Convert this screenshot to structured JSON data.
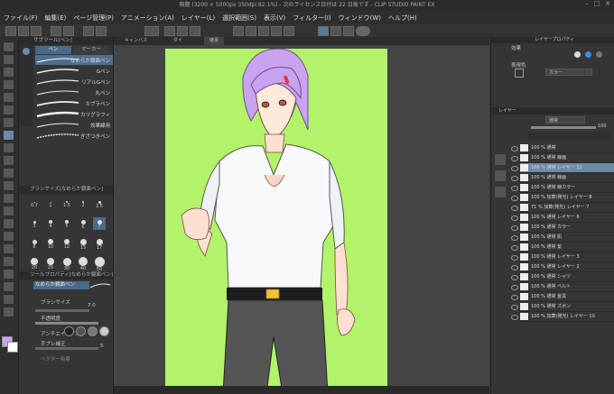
{
  "titlebar": {
    "title": "無題 (3200 × 5000px 350dpi 82.1%) - 次のライセンス日付は 22 日後です - CLIP STUDIO PAINT EX"
  },
  "menu": [
    "ファイル(F)",
    "編集(E)",
    "ページ管理(P)",
    "アニメーション(A)",
    "レイヤー(L)",
    "選択範囲(S)",
    "表示(V)",
    "フィルター(I)",
    "ウィンドウ(W)",
    "ヘルプ(H)"
  ],
  "canvas_tabs": [
    "キャンバス",
    "ダイ",
    "継承"
  ],
  "subtool": {
    "header": "サブツール[ペン]",
    "tabs": [
      "ペン",
      "マーカー"
    ],
    "brushes": [
      "なめらか鏡面ペン",
      "Gペン",
      "リアルGペン",
      "丸ペン",
      "カブラペン",
      "カリグラフィ",
      "効果線用",
      "ぎざつきペン"
    ],
    "size_header": "ブラシサイズ[なめらか鏡面ペン]",
    "sizes": [
      "0.7",
      "1",
      "1.5",
      "2",
      "2.5",
      "3",
      "4",
      "5",
      "6",
      "7",
      "8",
      "10",
      "12",
      "15",
      "17",
      "20",
      "25",
      "30",
      "40",
      "50"
    ],
    "detail_header": "ツールプロパティ[なめらか鏡面ペン]",
    "detail_name": "なめらか鏡面ペン",
    "props": {
      "brush_size_label": "ブラシサイズ",
      "brush_size_value": "7.0",
      "opacity_label": "不透明度",
      "antialias_label": "アンチエイリアス",
      "stabilize_label": "手ブレ補正",
      "stabilize_value": "5",
      "vector_label": "ベクター吸着"
    }
  },
  "color": {
    "header": "レイヤープロパティ",
    "effect_label": "効果",
    "display_color_label": "表現色",
    "display_color_value": "カラー"
  },
  "layer_panel": {
    "header": "レイヤー",
    "blend": "通常",
    "opacity": "100",
    "layers": [
      {
        "name": "100 % 通常",
        "selected": false
      },
      {
        "name": "100 % 通常 線画",
        "selected": false
      },
      {
        "name": "100 % 通常 レイヤー 11",
        "selected": true
      },
      {
        "name": "100 % 通常 線画",
        "selected": false
      },
      {
        "name": "100 % 通常 線カラー",
        "selected": false
      },
      {
        "name": "100 % 加算(発光) レイヤー 8",
        "selected": false
      },
      {
        "name": "71 % 加算(発光) レイヤー 7",
        "selected": false
      },
      {
        "name": "100 % 通常 レイヤー 6",
        "selected": false
      },
      {
        "name": "100 % 通常 カラー",
        "selected": false
      },
      {
        "name": "100 % 通常 肌",
        "selected": false
      },
      {
        "name": "100 % 通常 髪",
        "selected": false
      },
      {
        "name": "100 % 通常 レイヤー 3",
        "selected": false
      },
      {
        "name": "100 % 通常 レイヤー 2",
        "selected": false
      },
      {
        "name": "100 % 通常 シャツ",
        "selected": false
      },
      {
        "name": "100 % 通常 ベルト",
        "selected": false
      },
      {
        "name": "100 % 通常 金具",
        "selected": false
      },
      {
        "name": "100 % 通常 ズボン",
        "selected": false
      },
      {
        "name": "100 % 加算(発光) レイヤー 10",
        "selected": false
      }
    ]
  },
  "colors": {
    "canvas_bg": "#b3f36a",
    "hair": "#c9a3f0",
    "selected_layer": "#6d8aa8"
  }
}
